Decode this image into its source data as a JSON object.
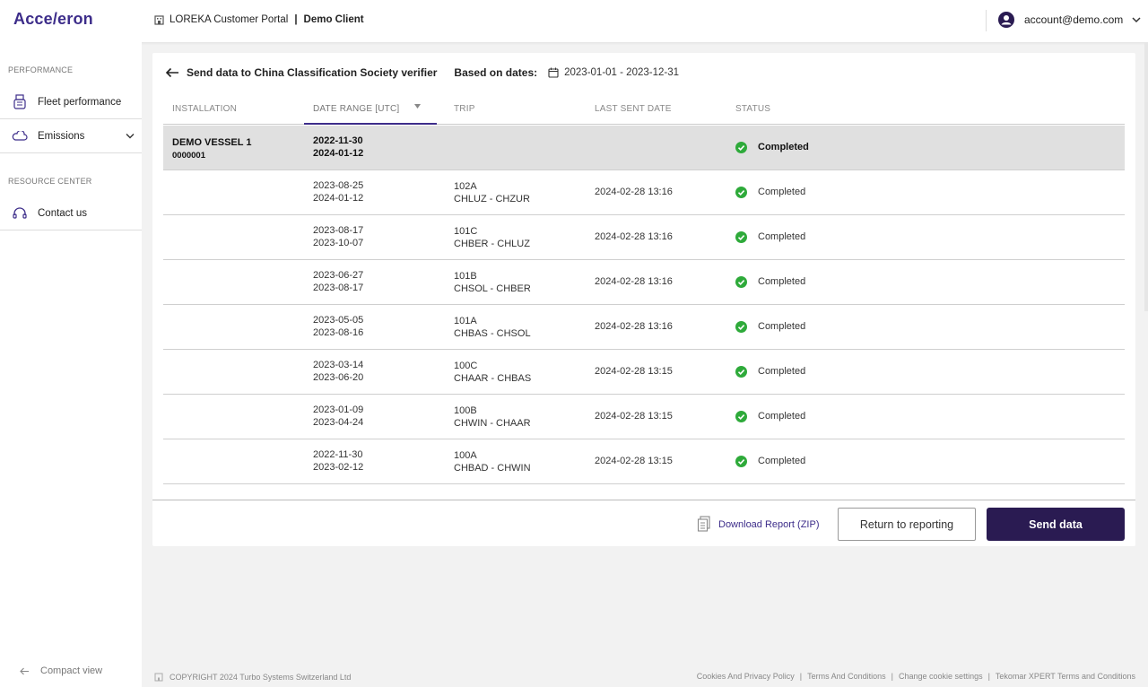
{
  "header": {
    "logo": "Acce/eron",
    "portal": "LOREKA Customer Portal",
    "separator": "|",
    "client": "Demo Client",
    "account": "account@demo.com"
  },
  "sidebar": {
    "section_performance": "PERFORMANCE",
    "fleet_performance": "Fleet performance",
    "emissions": "Emissions",
    "section_resource": "RESOURCE CENTER",
    "contact": "Contact us",
    "compact": "Compact view"
  },
  "page": {
    "title": "Send data to China Classification Society verifier",
    "based_on": "Based on dates:",
    "dates": "2023-01-01 - 2023-12-31"
  },
  "table": {
    "headers": {
      "installation": "INSTALLATION",
      "date_range": "DATE RANGE [UTC]",
      "trip": "TRIP",
      "last_sent": "LAST SENT DATE",
      "status": "STATUS"
    },
    "group": {
      "name": "DEMO VESSEL 1",
      "id": "0000001",
      "start": "2022-11-30",
      "end": "2024-01-12",
      "status": "Completed"
    },
    "rows": [
      {
        "start": "2023-08-25",
        "end": "2024-01-12",
        "trip": "102A",
        "route": "CHLUZ - CHZUR",
        "sent": "2024-02-28 13:16",
        "status": "Completed"
      },
      {
        "start": "2023-08-17",
        "end": "2023-10-07",
        "trip": "101C",
        "route": "CHBER - CHLUZ",
        "sent": "2024-02-28 13:16",
        "status": "Completed"
      },
      {
        "start": "2023-06-27",
        "end": "2023-08-17",
        "trip": "101B",
        "route": "CHSOL - CHBER",
        "sent": "2024-02-28 13:16",
        "status": "Completed"
      },
      {
        "start": "2023-05-05",
        "end": "2023-08-16",
        "trip": "101A",
        "route": "CHBAS - CHSOL",
        "sent": "2024-02-28 13:16",
        "status": "Completed"
      },
      {
        "start": "2023-03-14",
        "end": "2023-06-20",
        "trip": "100C",
        "route": "CHAAR - CHBAS",
        "sent": "2024-02-28 13:15",
        "status": "Completed"
      },
      {
        "start": "2023-01-09",
        "end": "2023-04-24",
        "trip": "100B",
        "route": "CHWIN - CHAAR",
        "sent": "2024-02-28 13:15",
        "status": "Completed"
      },
      {
        "start": "2022-11-30",
        "end": "2023-02-12",
        "trip": "100A",
        "route": "CHBAD - CHWIN",
        "sent": "2024-02-28 13:15",
        "status": "Completed"
      }
    ]
  },
  "actions": {
    "download": "Download Report (ZIP)",
    "return": "Return to reporting",
    "send": "Send data"
  },
  "footer": {
    "copyright": "COPYRIGHT 2024 Turbo Systems Switzerland Ltd",
    "cookies": "Cookies And Privacy Policy",
    "terms": "Terms And Conditions",
    "cookie_settings": "Change cookie settings",
    "tekomar": "Tekomar XPERT Terms and Conditions",
    "sep": "|"
  },
  "colors": {
    "brand": "#3d2d8a",
    "primary_button": "#2a1b52",
    "success": "#2eaa3a",
    "group_row": "#e0e0e0"
  },
  "icons": [
    "home-icon",
    "account-icon",
    "chevron-down-icon",
    "fleet-icon",
    "cloud-icon",
    "headset-icon",
    "arrow-left-icon",
    "calendar-icon",
    "sort-caret-icon",
    "check-circle-icon",
    "document-icon"
  ]
}
